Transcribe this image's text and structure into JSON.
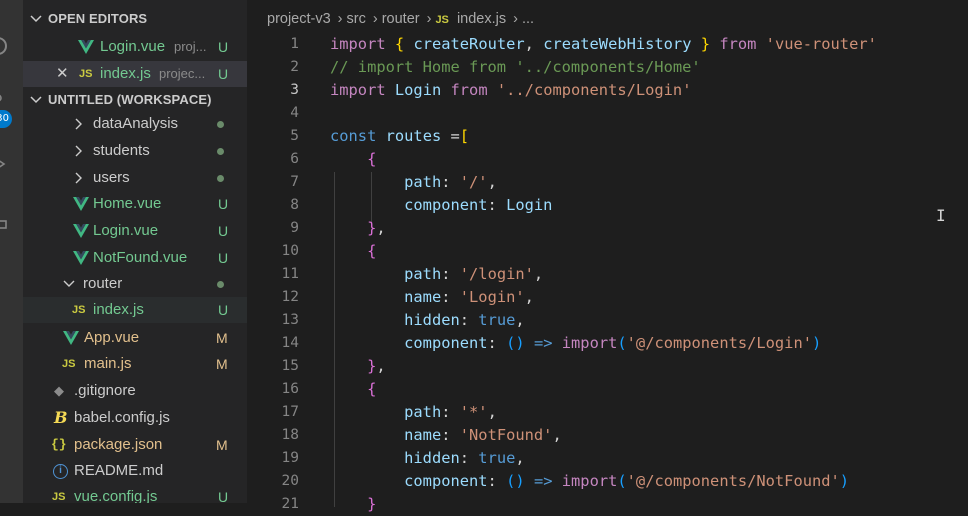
{
  "colors": {
    "accent": "#007acc",
    "untracked": "#73c991",
    "modified": "#e2c08d",
    "vue_green": "#41b883"
  },
  "activity": {
    "badge": "30"
  },
  "open_editors": {
    "header": "OPEN EDITORS",
    "items": [
      {
        "name": "Login.vue",
        "desc": "proj...",
        "status": "U"
      },
      {
        "name": "index.js",
        "desc": "projec...",
        "status": "U"
      }
    ]
  },
  "workspace": {
    "header": "UNTITLED (WORKSPACE)",
    "items": [
      {
        "name": "dataAnalysis"
      },
      {
        "name": "students"
      },
      {
        "name": "users"
      },
      {
        "name": "Home.vue",
        "status": "U"
      },
      {
        "name": "Login.vue",
        "status": "U"
      },
      {
        "name": "NotFound.vue",
        "status": "U"
      },
      {
        "name": "router"
      },
      {
        "name": "index.js",
        "status": "U"
      },
      {
        "name": "App.vue",
        "status": "M"
      },
      {
        "name": "main.js",
        "status": "M"
      },
      {
        "name": ".gitignore"
      },
      {
        "name": "babel.config.js"
      },
      {
        "name": "package.json",
        "status": "M"
      },
      {
        "name": "README.md"
      },
      {
        "name": "vue.config.js",
        "status": "U"
      }
    ]
  },
  "breadcrumb": [
    "project-v3",
    "src",
    "router",
    "index.js",
    "..."
  ],
  "editor": {
    "line_numbers": [
      "1",
      "2",
      "3",
      "4",
      "5",
      "6",
      "7",
      "8",
      "9",
      "10",
      "11",
      "12",
      "13",
      "14",
      "15",
      "16",
      "17",
      "18",
      "19",
      "20",
      "21"
    ],
    "lines": [
      "import { createRouter, createWebHistory } from 'vue-router'",
      "// import Home from '../components/Home'",
      "import Login from '../components/Login'",
      "",
      "const routes =[",
      "    {",
      "        path: '/',",
      "        component: Login",
      "    },",
      "    {",
      "        path: '/login',",
      "        name: 'Login',",
      "        hidden: true,",
      "        component: () => import('@/components/Login')",
      "    },",
      "    {",
      "        path: '*',",
      "        name: 'NotFound',",
      "        hidden: true,",
      "        component: () => import('@/components/NotFound')",
      "    }"
    ]
  }
}
